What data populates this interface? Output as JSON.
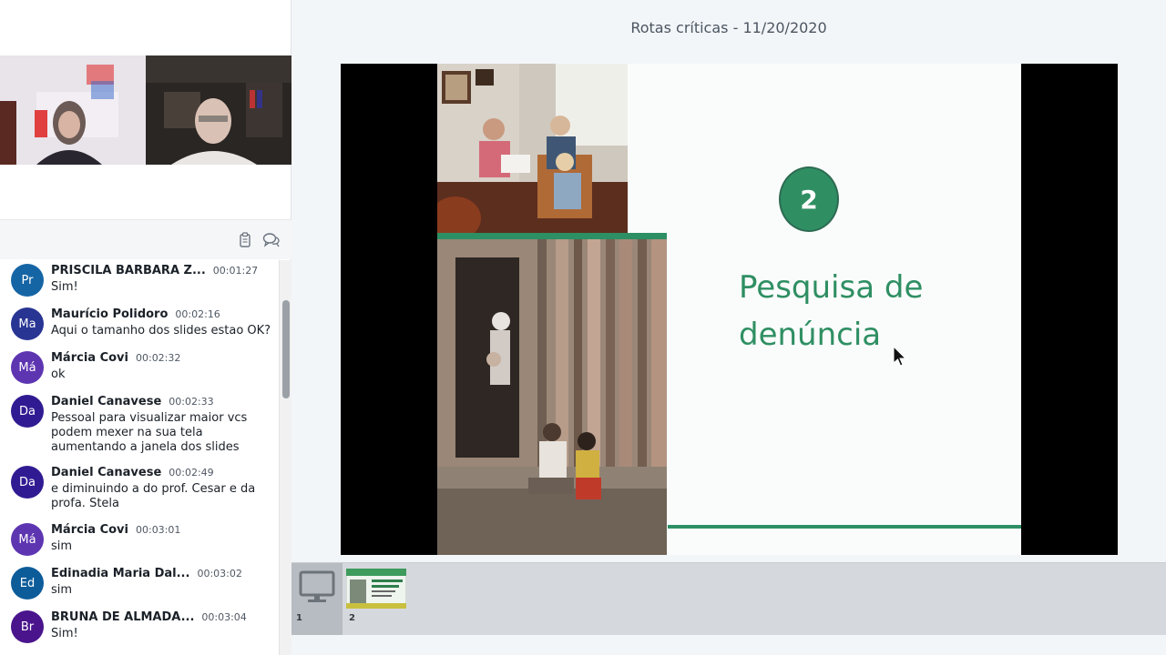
{
  "presentation": {
    "title": "Rotas críticas - 11/20/2020"
  },
  "chat": {
    "messages": [
      {
        "initials": "Pr",
        "name": "PRISCILA BARBARA Z...",
        "time": "00:01:27",
        "text": "Sim!",
        "color": "#1565a5"
      },
      {
        "initials": "Ma",
        "name": "Maurício Polidoro",
        "time": "00:02:16",
        "text": "Aqui o tamanho dos slides estao OK?",
        "color": "#283593"
      },
      {
        "initials": "Má",
        "name": "Márcia Covi",
        "time": "00:02:32",
        "text": "ok",
        "color": "#5e35b1"
      },
      {
        "initials": "Da",
        "name": "Daniel Canavese",
        "time": "00:02:33",
        "text": "Pessoal para visualizar maior vcs podem mexer na sua tela aumentando a janela dos slides",
        "color": "#311b92"
      },
      {
        "initials": "Da",
        "name": "Daniel Canavese",
        "time": "00:02:49",
        "text": "e diminuindo a do prof. Cesar e da profa. Stela",
        "color": "#311b92"
      },
      {
        "initials": "Má",
        "name": "Márcia Covi",
        "time": "00:03:01",
        "text": "sim",
        "color": "#5e35b1"
      },
      {
        "initials": "Ed",
        "name": "Edinadia Maria Dal...",
        "time": "00:03:02",
        "text": "sim",
        "color": "#0d5c9a"
      },
      {
        "initials": "Br",
        "name": "BRUNA DE ALMADA...",
        "time": "00:03:04",
        "text": "Sim!",
        "color": "#4a148c"
      }
    ],
    "header_icons": [
      "copy-icon",
      "chat-bubbles-icon"
    ]
  },
  "slide": {
    "number": "2",
    "heading_line1": "Pesquisa de",
    "heading_line2": "denúncia",
    "accent_color": "#2f8f63"
  },
  "thumbnails": [
    {
      "number": "1",
      "icon": "desktop-icon"
    },
    {
      "number": "2"
    }
  ]
}
